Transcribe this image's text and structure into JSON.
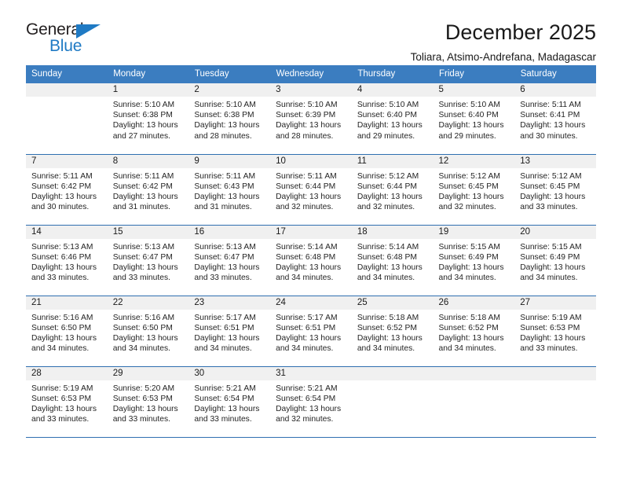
{
  "logo": {
    "word_top": "General",
    "word_bottom": "Blue",
    "triangle_color": "#1f7ac4",
    "text_color": "#231f20"
  },
  "header": {
    "title": "December 2025",
    "subtitle": "Toliara, Atsimo-Andrefana, Madagascar"
  },
  "theme": {
    "header_bg": "#3b7dc0",
    "header_text": "#ffffff",
    "daynum_bg": "#f0f0f0",
    "grid_line": "#2f6fb0"
  },
  "calendar": {
    "weekday_headers": [
      "Sunday",
      "Monday",
      "Tuesday",
      "Wednesday",
      "Thursday",
      "Friday",
      "Saturday"
    ],
    "labels": {
      "sunrise": "Sunrise:",
      "sunset": "Sunset:",
      "daylight": "Daylight:"
    },
    "weeks": [
      [
        {
          "day": "",
          "empty": true
        },
        {
          "day": "1",
          "sunrise": "Sunrise: 5:10 AM",
          "sunset": "Sunset: 6:38 PM",
          "daylight_1": "Daylight: 13 hours",
          "daylight_2": "and 27 minutes."
        },
        {
          "day": "2",
          "sunrise": "Sunrise: 5:10 AM",
          "sunset": "Sunset: 6:38 PM",
          "daylight_1": "Daylight: 13 hours",
          "daylight_2": "and 28 minutes."
        },
        {
          "day": "3",
          "sunrise": "Sunrise: 5:10 AM",
          "sunset": "Sunset: 6:39 PM",
          "daylight_1": "Daylight: 13 hours",
          "daylight_2": "and 28 minutes."
        },
        {
          "day": "4",
          "sunrise": "Sunrise: 5:10 AM",
          "sunset": "Sunset: 6:40 PM",
          "daylight_1": "Daylight: 13 hours",
          "daylight_2": "and 29 minutes."
        },
        {
          "day": "5",
          "sunrise": "Sunrise: 5:10 AM",
          "sunset": "Sunset: 6:40 PM",
          "daylight_1": "Daylight: 13 hours",
          "daylight_2": "and 29 minutes."
        },
        {
          "day": "6",
          "sunrise": "Sunrise: 5:11 AM",
          "sunset": "Sunset: 6:41 PM",
          "daylight_1": "Daylight: 13 hours",
          "daylight_2": "and 30 minutes."
        }
      ],
      [
        {
          "day": "7",
          "sunrise": "Sunrise: 5:11 AM",
          "sunset": "Sunset: 6:42 PM",
          "daylight_1": "Daylight: 13 hours",
          "daylight_2": "and 30 minutes."
        },
        {
          "day": "8",
          "sunrise": "Sunrise: 5:11 AM",
          "sunset": "Sunset: 6:42 PM",
          "daylight_1": "Daylight: 13 hours",
          "daylight_2": "and 31 minutes."
        },
        {
          "day": "9",
          "sunrise": "Sunrise: 5:11 AM",
          "sunset": "Sunset: 6:43 PM",
          "daylight_1": "Daylight: 13 hours",
          "daylight_2": "and 31 minutes."
        },
        {
          "day": "10",
          "sunrise": "Sunrise: 5:11 AM",
          "sunset": "Sunset: 6:44 PM",
          "daylight_1": "Daylight: 13 hours",
          "daylight_2": "and 32 minutes."
        },
        {
          "day": "11",
          "sunrise": "Sunrise: 5:12 AM",
          "sunset": "Sunset: 6:44 PM",
          "daylight_1": "Daylight: 13 hours",
          "daylight_2": "and 32 minutes."
        },
        {
          "day": "12",
          "sunrise": "Sunrise: 5:12 AM",
          "sunset": "Sunset: 6:45 PM",
          "daylight_1": "Daylight: 13 hours",
          "daylight_2": "and 32 minutes."
        },
        {
          "day": "13",
          "sunrise": "Sunrise: 5:12 AM",
          "sunset": "Sunset: 6:45 PM",
          "daylight_1": "Daylight: 13 hours",
          "daylight_2": "and 33 minutes."
        }
      ],
      [
        {
          "day": "14",
          "sunrise": "Sunrise: 5:13 AM",
          "sunset": "Sunset: 6:46 PM",
          "daylight_1": "Daylight: 13 hours",
          "daylight_2": "and 33 minutes."
        },
        {
          "day": "15",
          "sunrise": "Sunrise: 5:13 AM",
          "sunset": "Sunset: 6:47 PM",
          "daylight_1": "Daylight: 13 hours",
          "daylight_2": "and 33 minutes."
        },
        {
          "day": "16",
          "sunrise": "Sunrise: 5:13 AM",
          "sunset": "Sunset: 6:47 PM",
          "daylight_1": "Daylight: 13 hours",
          "daylight_2": "and 33 minutes."
        },
        {
          "day": "17",
          "sunrise": "Sunrise: 5:14 AM",
          "sunset": "Sunset: 6:48 PM",
          "daylight_1": "Daylight: 13 hours",
          "daylight_2": "and 34 minutes."
        },
        {
          "day": "18",
          "sunrise": "Sunrise: 5:14 AM",
          "sunset": "Sunset: 6:48 PM",
          "daylight_1": "Daylight: 13 hours",
          "daylight_2": "and 34 minutes."
        },
        {
          "day": "19",
          "sunrise": "Sunrise: 5:15 AM",
          "sunset": "Sunset: 6:49 PM",
          "daylight_1": "Daylight: 13 hours",
          "daylight_2": "and 34 minutes."
        },
        {
          "day": "20",
          "sunrise": "Sunrise: 5:15 AM",
          "sunset": "Sunset: 6:49 PM",
          "daylight_1": "Daylight: 13 hours",
          "daylight_2": "and 34 minutes."
        }
      ],
      [
        {
          "day": "21",
          "sunrise": "Sunrise: 5:16 AM",
          "sunset": "Sunset: 6:50 PM",
          "daylight_1": "Daylight: 13 hours",
          "daylight_2": "and 34 minutes."
        },
        {
          "day": "22",
          "sunrise": "Sunrise: 5:16 AM",
          "sunset": "Sunset: 6:50 PM",
          "daylight_1": "Daylight: 13 hours",
          "daylight_2": "and 34 minutes."
        },
        {
          "day": "23",
          "sunrise": "Sunrise: 5:17 AM",
          "sunset": "Sunset: 6:51 PM",
          "daylight_1": "Daylight: 13 hours",
          "daylight_2": "and 34 minutes."
        },
        {
          "day": "24",
          "sunrise": "Sunrise: 5:17 AM",
          "sunset": "Sunset: 6:51 PM",
          "daylight_1": "Daylight: 13 hours",
          "daylight_2": "and 34 minutes."
        },
        {
          "day": "25",
          "sunrise": "Sunrise: 5:18 AM",
          "sunset": "Sunset: 6:52 PM",
          "daylight_1": "Daylight: 13 hours",
          "daylight_2": "and 34 minutes."
        },
        {
          "day": "26",
          "sunrise": "Sunrise: 5:18 AM",
          "sunset": "Sunset: 6:52 PM",
          "daylight_1": "Daylight: 13 hours",
          "daylight_2": "and 34 minutes."
        },
        {
          "day": "27",
          "sunrise": "Sunrise: 5:19 AM",
          "sunset": "Sunset: 6:53 PM",
          "daylight_1": "Daylight: 13 hours",
          "daylight_2": "and 33 minutes."
        }
      ],
      [
        {
          "day": "28",
          "sunrise": "Sunrise: 5:19 AM",
          "sunset": "Sunset: 6:53 PM",
          "daylight_1": "Daylight: 13 hours",
          "daylight_2": "and 33 minutes."
        },
        {
          "day": "29",
          "sunrise": "Sunrise: 5:20 AM",
          "sunset": "Sunset: 6:53 PM",
          "daylight_1": "Daylight: 13 hours",
          "daylight_2": "and 33 minutes."
        },
        {
          "day": "30",
          "sunrise": "Sunrise: 5:21 AM",
          "sunset": "Sunset: 6:54 PM",
          "daylight_1": "Daylight: 13 hours",
          "daylight_2": "and 33 minutes."
        },
        {
          "day": "31",
          "sunrise": "Sunrise: 5:21 AM",
          "sunset": "Sunset: 6:54 PM",
          "daylight_1": "Daylight: 13 hours",
          "daylight_2": "and 32 minutes."
        },
        {
          "day": "",
          "empty": true
        },
        {
          "day": "",
          "empty": true
        },
        {
          "day": "",
          "empty": true
        }
      ]
    ]
  }
}
